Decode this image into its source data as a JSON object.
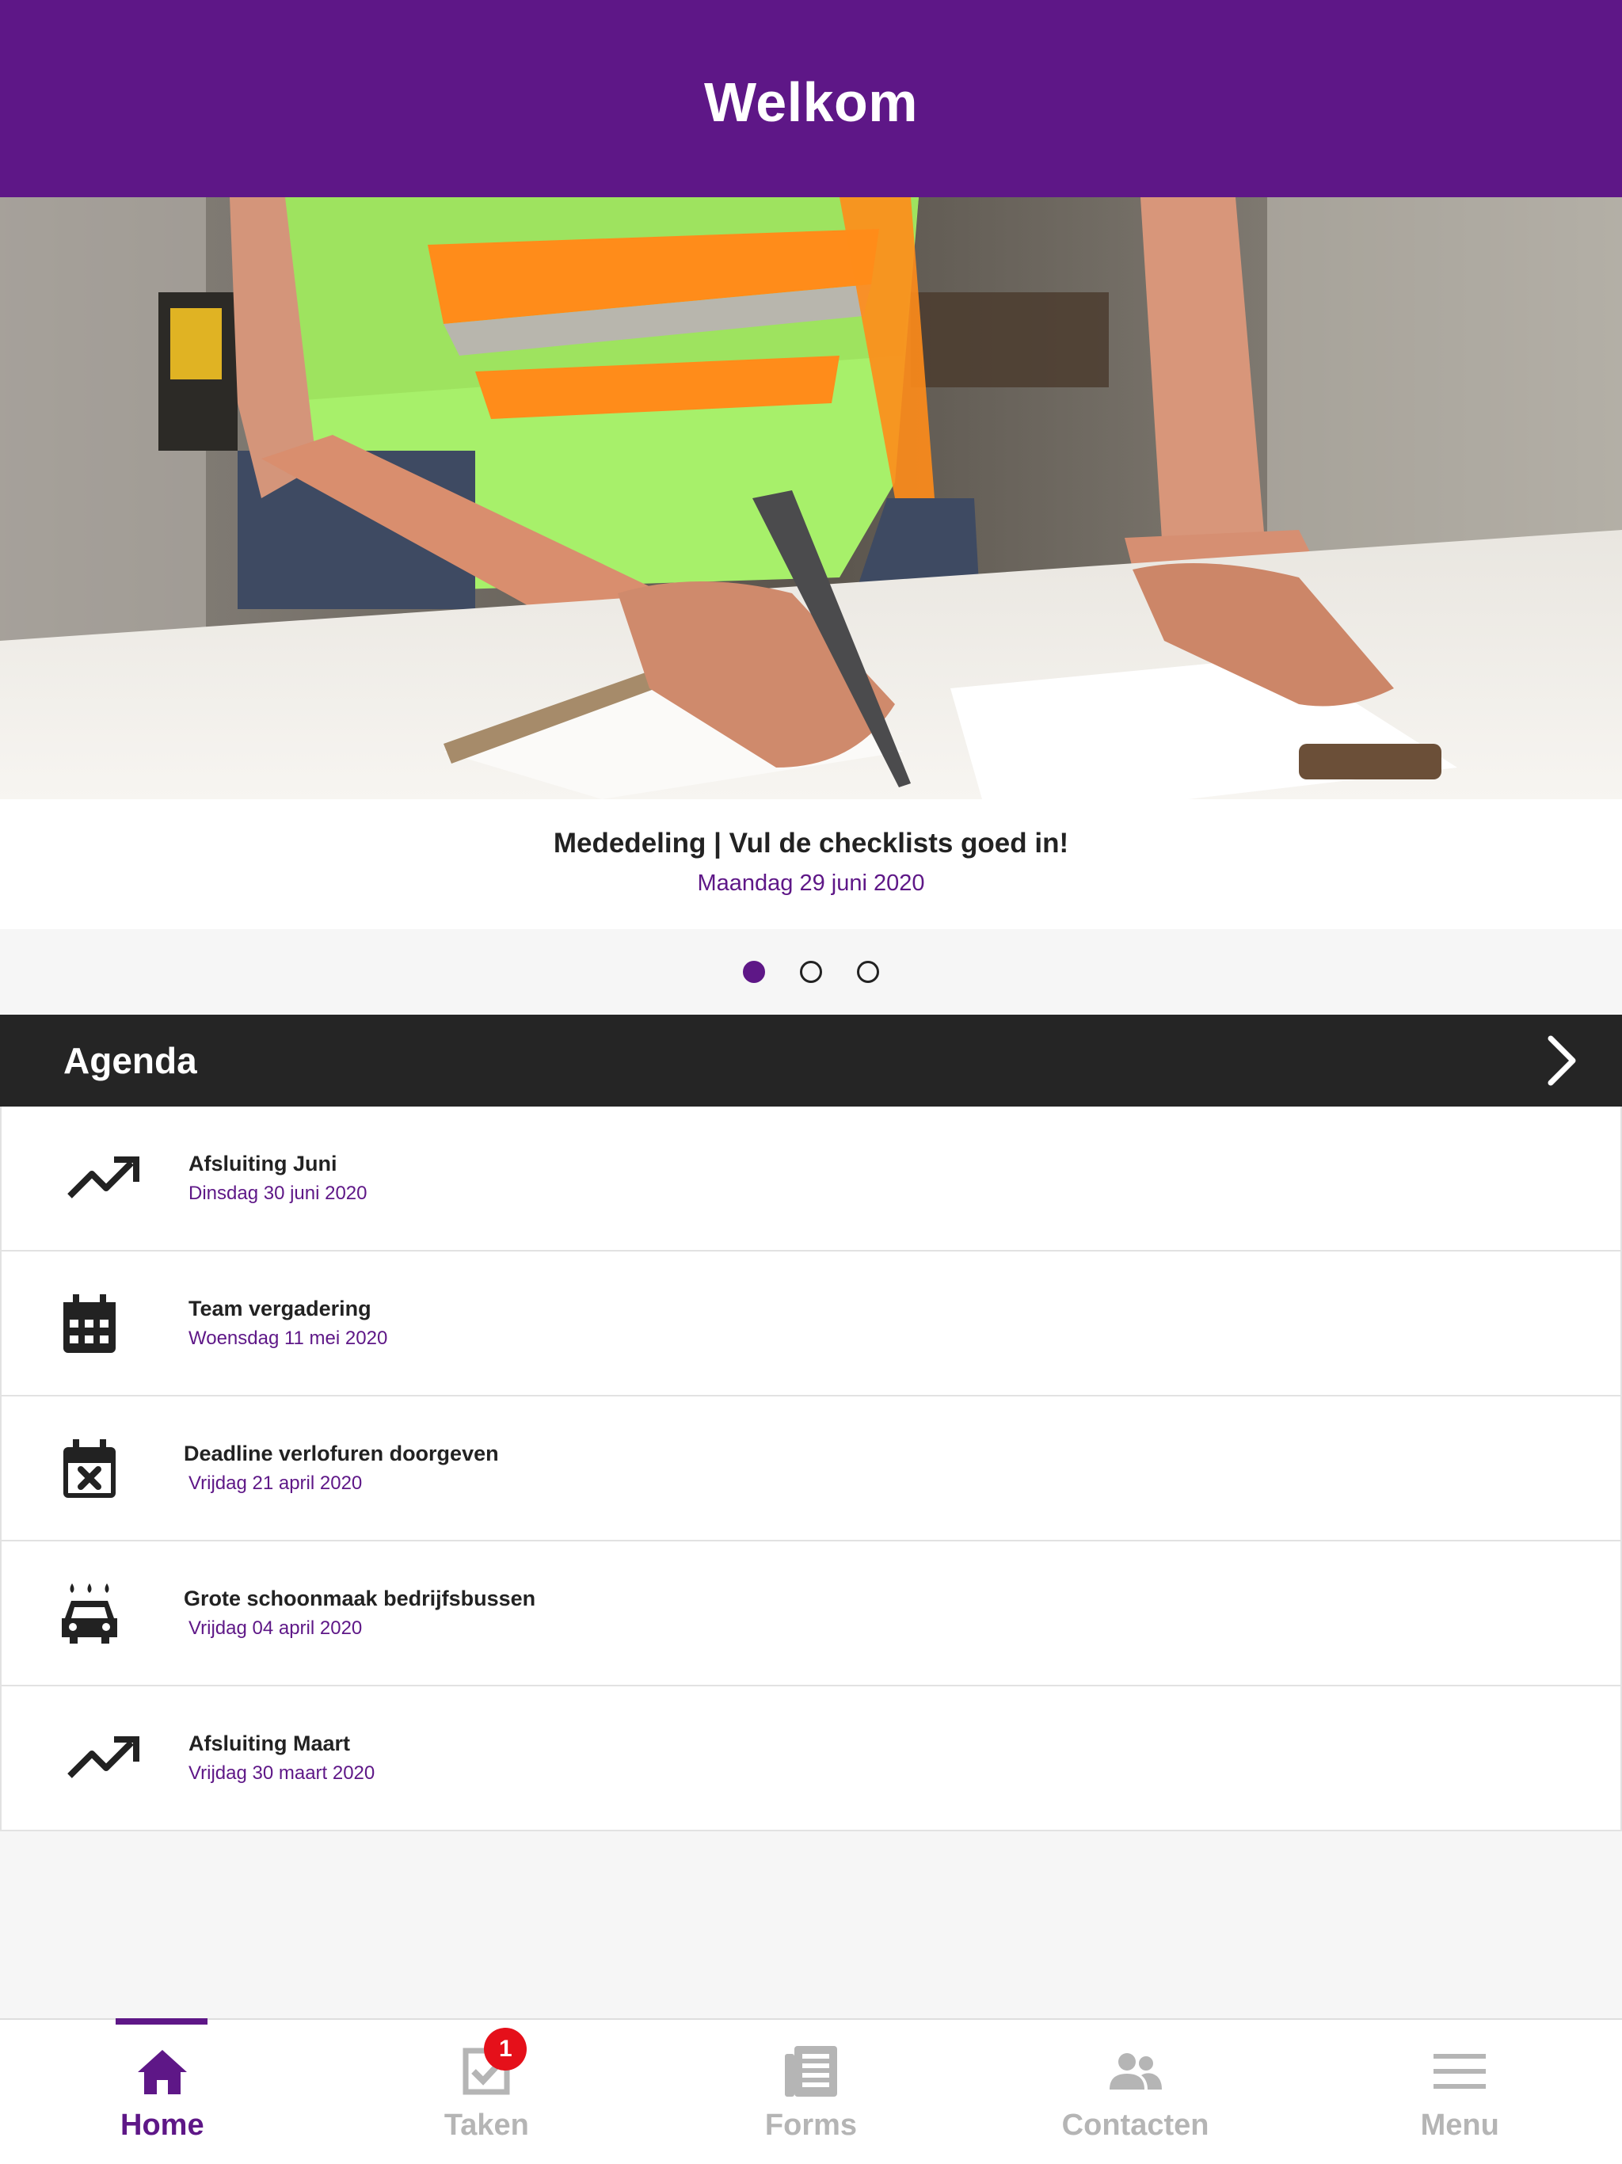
{
  "header": {
    "title": "Welkom"
  },
  "carousel": {
    "title": "Mededeling | Vul de checklists goed in!",
    "date": "Maandag 29 juni 2020",
    "page_count": 3,
    "active_index": 0
  },
  "agenda": {
    "label": "Agenda",
    "items": [
      {
        "icon": "trending-up-icon",
        "title": "Afsluiting Juni",
        "date": "Dinsdag 30 juni 2020"
      },
      {
        "icon": "calendar-icon",
        "title": "Team vergadering",
        "date": "Woensdag 11 mei 2020"
      },
      {
        "icon": "calendar-x-icon",
        "title": "Deadline verlofuren doorgeven",
        "date": "Vrijdag 21 april 2020"
      },
      {
        "icon": "car-wash-icon",
        "title": "Grote schoonmaak bedrijfsbussen",
        "date": "Vrijdag 04 april 2020"
      },
      {
        "icon": "trending-up-icon",
        "title": "Afsluiting Maart",
        "date": "Vrijdag 30 maart 2020"
      }
    ]
  },
  "tabs": [
    {
      "label": "Home",
      "icon": "home-icon",
      "active": true
    },
    {
      "label": "Taken",
      "icon": "checkbox-icon",
      "badge": "1"
    },
    {
      "label": "Forms",
      "icon": "document-icon"
    },
    {
      "label": "Contacten",
      "icon": "people-icon"
    },
    {
      "label": "Menu",
      "icon": "menu-icon"
    }
  ],
  "colors": {
    "brand": "#5e1787",
    "dark": "#252525",
    "badge": "#e5101a"
  }
}
